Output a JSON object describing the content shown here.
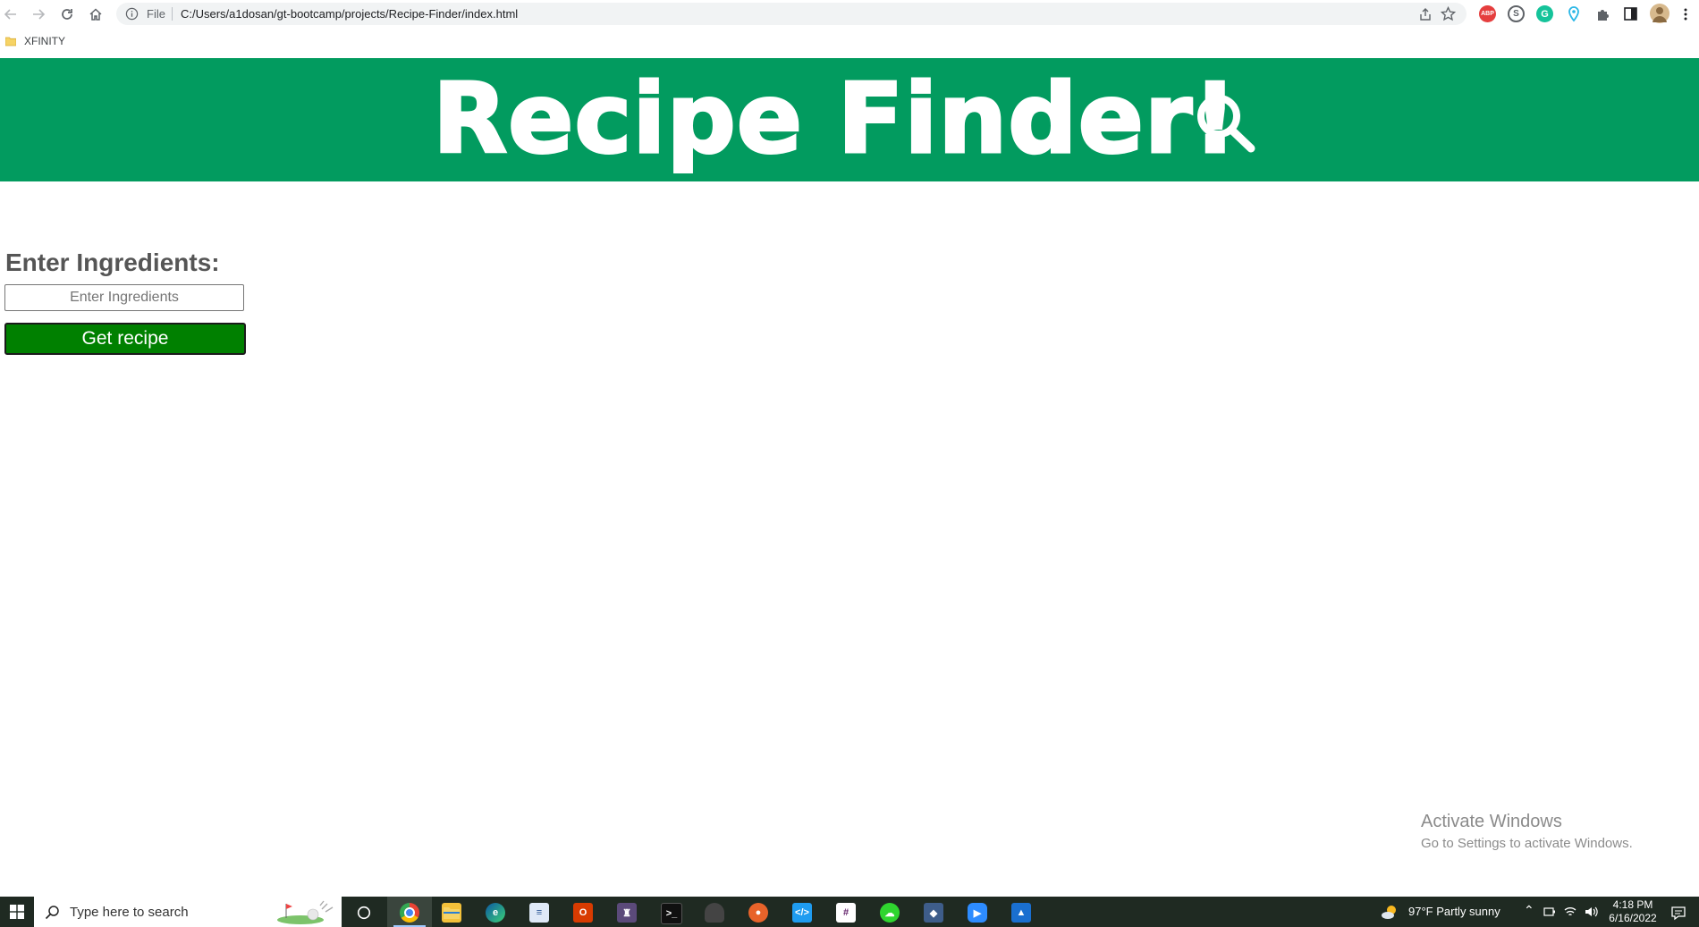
{
  "browser": {
    "url_scheme_label": "File",
    "url": "C:/Users/a1dosan/gt-bootcamp/projects/Recipe-Finder/index.html",
    "extensions": [
      {
        "name": "adblock-plus",
        "label": "ABP",
        "color": "#e53e3e"
      },
      {
        "name": "skype",
        "label": "",
        "color": "#5f6368"
      },
      {
        "name": "grammarly",
        "label": "G",
        "color": "#15c39a"
      },
      {
        "name": "location",
        "label": "",
        "color": "#2bb7e6"
      }
    ]
  },
  "bookmarks": [
    {
      "label": "XFINITY"
    }
  ],
  "page": {
    "title": "Recipe Finder!",
    "ingredients_label": "Enter Ingredients:",
    "ingredients_placeholder": "Enter Ingredients",
    "ingredients_value": "",
    "submit_label": "Get recipe",
    "brand_color": "#029b5f",
    "button_color": "#008000"
  },
  "watermark": {
    "title": "Activate Windows",
    "subtitle": "Go to Settings to activate Windows."
  },
  "taskbar": {
    "search_placeholder": "Type here to search",
    "apps": [
      "cortana",
      "chrome",
      "file-explorer",
      "edge",
      "notepad",
      "office",
      "game",
      "terminal",
      "helmet-app",
      "media",
      "vscode",
      "slack",
      "cloud-app",
      "git-kraken",
      "zoom",
      "photos"
    ],
    "weather": "97°F  Partly sunny",
    "time": "4:18 PM",
    "date": "6/16/2022"
  }
}
